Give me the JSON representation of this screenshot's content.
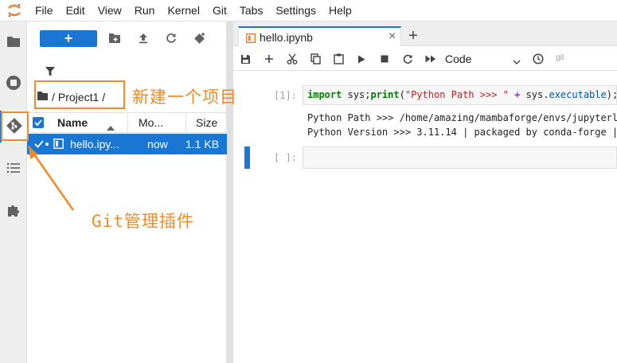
{
  "menubar": {
    "items": [
      "File",
      "Edit",
      "View",
      "Run",
      "Kernel",
      "Git",
      "Tabs",
      "Settings",
      "Help"
    ]
  },
  "activity_bar": {
    "items": [
      "folder-icon",
      "running-icon",
      "git-icon",
      "toc-icon",
      "extension-icon"
    ],
    "active": "git-icon"
  },
  "file_browser": {
    "new_button_label": "+",
    "toolbar_icons": [
      "new-folder-icon",
      "upload-icon",
      "refresh-icon",
      "git-clone-icon"
    ],
    "breadcrumb": {
      "prefix": "/",
      "folder": "Project1",
      "suffix": "/"
    },
    "columns": {
      "name": "Name",
      "modified": "Mo...",
      "size": "Size"
    },
    "files": [
      {
        "name": "hello.ipy...",
        "modified": "now",
        "size": "1.1 KB",
        "selected": true
      }
    ]
  },
  "tabs": [
    {
      "label": "hello.ipynb",
      "active": true
    }
  ],
  "new_tab_label": "+",
  "notebook_toolbar": {
    "icons": [
      "save-icon",
      "add-cell-icon",
      "cut-icon",
      "copy-icon",
      "paste-icon",
      "run-icon",
      "stop-icon",
      "restart-icon",
      "fast-forward-icon"
    ],
    "cell_type": "Code",
    "git_label": "git"
  },
  "cells": [
    {
      "prompt": "[1]:",
      "code_tokens": [
        {
          "t": "import",
          "c": "kw"
        },
        {
          "t": " sys;",
          "c": "ident"
        },
        {
          "t": "print",
          "c": "kw"
        },
        {
          "t": "(",
          "c": "ident"
        },
        {
          "t": "\"Python Path >>> \"",
          "c": "str"
        },
        {
          "t": " + ",
          "c": "op"
        },
        {
          "t": "sys.",
          "c": "ident"
        },
        {
          "t": "executable",
          "c": "attr"
        },
        {
          "t": ");p",
          "c": "ident"
        }
      ],
      "output": [
        "Python Path >>> /home/amazing/mambaforge/envs/jupyterla",
        "Python Version >>> 3.11.14 | packaged by conda-forge |"
      ]
    },
    {
      "prompt": "[ ]:",
      "code_tokens": [],
      "output": []
    }
  ],
  "annotations": {
    "project_label": "新建一个项目",
    "git_label": "Git管理插件"
  },
  "colors": {
    "accent": "#1976d2",
    "annotation": "#f08a24"
  }
}
